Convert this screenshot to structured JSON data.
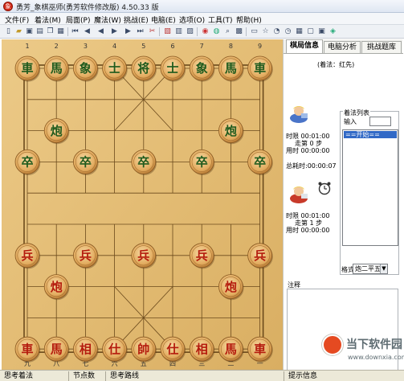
{
  "window": {
    "title": "勇芳_象棋巫师(勇芳软件修改版) 4.50.33 版"
  },
  "menu": [
    "文件(F)",
    "着法(M)",
    "局面(P)",
    "魔法(W)",
    "挑战(E)",
    "电脑(E)",
    "选项(O)",
    "工具(T)",
    "帮助(H)"
  ],
  "toolbar_icons": [
    "new-file-icon",
    "open-folder-icon",
    "save-icon",
    "print-icon",
    "copy-icon",
    "paste-icon",
    "first-move-icon",
    "prev-move-icon",
    "play-icon",
    "next-move-icon",
    "last-move-icon",
    "board-icon",
    "edit-icon",
    "list-icon",
    "grid-icon",
    "tree-icon",
    "refresh-icon",
    "globe-icon",
    "search-icon",
    "image-icon",
    "lock-icon",
    "star-icon",
    "clock-icon",
    "timer-icon",
    "settings-icon",
    "window-icon",
    "camera-icon",
    "web-icon"
  ],
  "board": {
    "top_numbers": [
      "1",
      "2",
      "3",
      "4",
      "5",
      "6",
      "7",
      "8",
      "9"
    ],
    "bottom_numbers": [
      "九",
      "八",
      "七",
      "六",
      "五",
      "四",
      "三",
      "二",
      "一"
    ],
    "black_back_row": [
      "車",
      "馬",
      "象",
      "士",
      "将",
      "士",
      "象",
      "馬",
      "車"
    ],
    "black_cannon": "炮",
    "black_soldier": "卒",
    "red_back_row": [
      "車",
      "馬",
      "相",
      "仕",
      "帥",
      "仕",
      "相",
      "馬",
      "車"
    ],
    "red_cannon": "炮",
    "red_soldier": "兵",
    "colors": {
      "board": "#e7c27c",
      "line": "#6b4a1c",
      "black_text": "#1f5a1c",
      "red_text": "#b41a0c",
      "piece": "#e6b26a"
    }
  },
  "tabs": [
    "棋局信息",
    "电脑分析",
    "挑战题库"
  ],
  "info": {
    "turn": "(着法：红先)",
    "black_player": {
      "time_limit": "时限 00:01:00",
      "moves": "走第 0 步",
      "used": "用时 00:00:00"
    },
    "total_time": "总耗时:00:00:07",
    "red_player": {
      "time_limit": "时限 00:01:00",
      "moves": "走第 1 步",
      "used": "用时 00:00:00"
    }
  },
  "move_list": {
    "title": "着法列表",
    "input_label": "输入",
    "first_entry": "==开始==",
    "format_label": "格式",
    "format_value": "炮二平五"
  },
  "notes_label": "注释",
  "status": [
    "思考着法",
    "节点数",
    "思考路线",
    "提示信息"
  ],
  "watermark": {
    "text": "当下软件园",
    "url": "www.downxia.com"
  }
}
